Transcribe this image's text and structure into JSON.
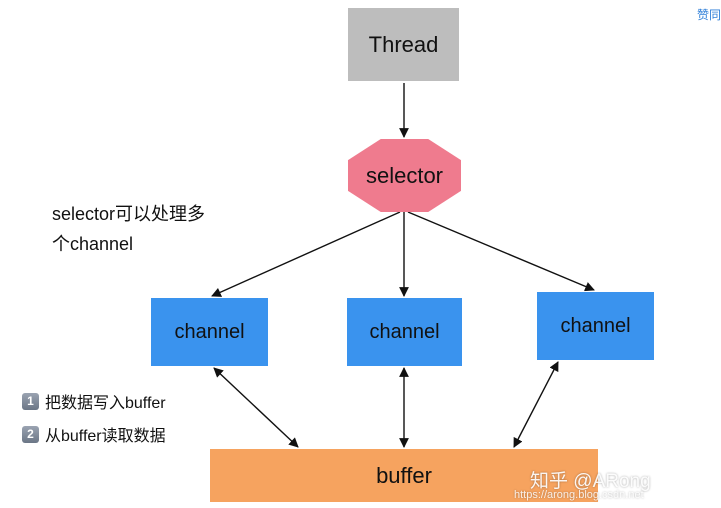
{
  "nodes": {
    "thread": "Thread",
    "selector": "selector",
    "channels": [
      "channel",
      "channel",
      "channel"
    ],
    "buffer": "buffer"
  },
  "note": {
    "line1": "selector可以处理多",
    "line2": "个channel"
  },
  "legend": [
    {
      "num": "1",
      "text": "把数据写入buffer"
    },
    {
      "num": "2",
      "text": "从buffer读取数据"
    }
  ],
  "corner_link": "赞同",
  "watermark": {
    "main": "知乎 @ARong",
    "url": "https://arong.blog.csdn.net"
  },
  "colors": {
    "thread": "#bdbdbd",
    "selector": "#ef7b8e",
    "channel": "#3a93ee",
    "buffer": "#f6a35f"
  }
}
